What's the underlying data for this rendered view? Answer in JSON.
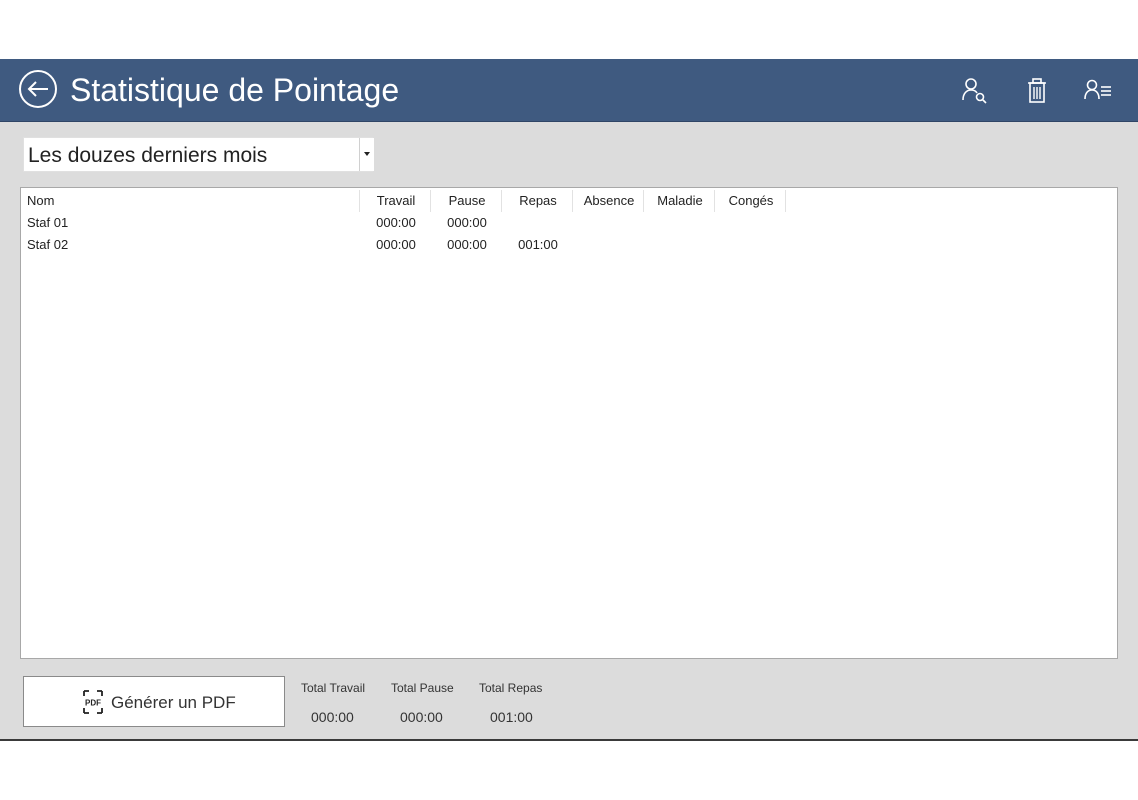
{
  "header": {
    "title": "Statistique de Pointage",
    "icons": [
      "back-arrow-icon",
      "user-search-icon",
      "trash-icon",
      "user-list-icon"
    ],
    "background": "#3f5a80"
  },
  "period_select": {
    "selected": "Les douzes derniers mois"
  },
  "table": {
    "columns": [
      "Nom",
      "Travail",
      "Pause",
      "Repas",
      "Absence",
      "Maladie",
      "Congés"
    ],
    "rows": [
      [
        "Staf 01",
        "000:00",
        "000:00",
        "",
        "",
        "",
        ""
      ],
      [
        "Staf 02",
        "000:00",
        "000:00",
        "001:00",
        "",
        "",
        ""
      ]
    ]
  },
  "footer": {
    "pdf_button_label": "Générer un PDF",
    "totals": [
      {
        "label": "Total Travail",
        "value": "000:00"
      },
      {
        "label": "Total Pause",
        "value": "000:00"
      },
      {
        "label": "Total Repas",
        "value": "001:00"
      }
    ]
  }
}
